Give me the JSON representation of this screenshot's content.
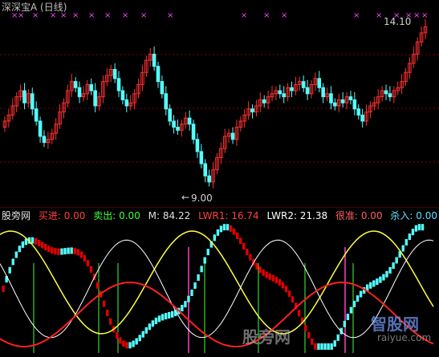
{
  "header": {
    "title": "深深宝A (日线)"
  },
  "price_labels": {
    "high": "14.10",
    "low": "9.00"
  },
  "indicator": {
    "name": "股旁网",
    "items": [
      {
        "label": "买进: 0.00",
        "color": "#ff4040"
      },
      {
        "label": "卖出: 0.00",
        "color": "#40ff40"
      },
      {
        "label": "M: 84.22",
        "color": "#e0e0e0"
      },
      {
        "label": "LWR1: 16.74",
        "color": "#ff4040"
      },
      {
        "label": "LWR2: 21.38",
        "color": "#ffffff"
      },
      {
        "label": "很准: 0.00",
        "color": "#ff6060"
      },
      {
        "label": "杀入: 0.00",
        "color": "#60e0ff"
      }
    ]
  },
  "watermark": {
    "site": "股旁网",
    "brand": "智股网",
    "url": "raiyue.com"
  },
  "colors": {
    "up": "#ff3030",
    "down": "#54ffff",
    "grid": "#8a0000",
    "ma_yellow": "#ffff40",
    "ma_white": "#ffffff",
    "marker": "#ff40ff"
  },
  "chart_data": {
    "type": "candlestick",
    "title": "深深宝A (日线)",
    "annotations": [
      {
        "text": "14.10",
        "kind": "high"
      },
      {
        "text": "9.00",
        "kind": "low"
      }
    ],
    "close_series": [
      11.0,
      11.2,
      11.5,
      11.8,
      12.0,
      11.6,
      11.9,
      11.4,
      11.0,
      10.5,
      10.3,
      10.4,
      10.6,
      10.9,
      11.3,
      11.6,
      12.0,
      12.3,
      12.1,
      11.8,
      11.9,
      12.2,
      12.0,
      11.5,
      11.8,
      12.3,
      12.5,
      12.7,
      12.4,
      12.0,
      11.7,
      11.5,
      11.6,
      11.9,
      12.2,
      12.6,
      13.0,
      13.2,
      12.8,
      12.3,
      11.9,
      11.4,
      11.0,
      10.8,
      10.7,
      10.9,
      11.1,
      10.9,
      10.4,
      10.0,
      9.6,
      9.2,
      9.0,
      9.4,
      9.8,
      10.1,
      10.5,
      10.6,
      10.4,
      10.8,
      11.0,
      11.2,
      11.4,
      11.3,
      11.5,
      11.7,
      11.6,
      11.8,
      11.9,
      12.0,
      11.9,
      11.8,
      12.1,
      12.0,
      12.2,
      12.3,
      12.1,
      11.9,
      12.2,
      12.4,
      12.1,
      11.8,
      11.9,
      11.6,
      11.5,
      11.7,
      11.6,
      11.8,
      11.7,
      11.4,
      11.2,
      11.0,
      11.3,
      11.5,
      11.6,
      11.8,
      12.0,
      11.9,
      11.8,
      12.0,
      12.1,
      12.3,
      12.6,
      12.9,
      13.2,
      13.6,
      13.9,
      14.1
    ]
  }
}
